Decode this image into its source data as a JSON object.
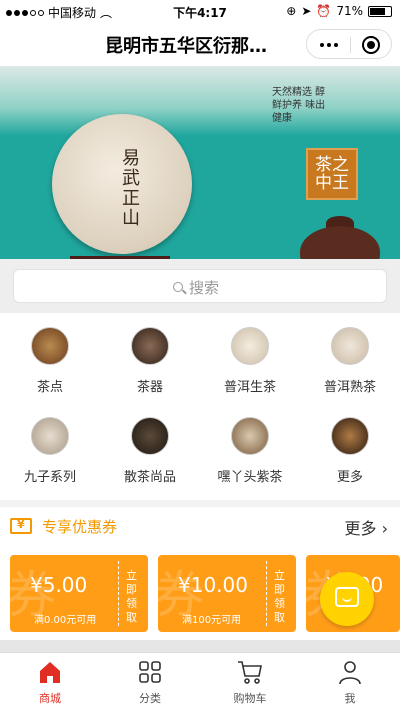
{
  "status_bar": {
    "carrier": "中国移动",
    "time": "下午4:17",
    "battery": "71%"
  },
  "nav": {
    "title": "昆明市五华区衍那…"
  },
  "banner": {
    "cake_text": "易武正山",
    "slogan": "天然精选 醇鲜护养 味出健康",
    "seal_text": "茶之中王",
    "slide_count": 3,
    "active_slide": 1
  },
  "search": {
    "placeholder": "搜索"
  },
  "categories": [
    {
      "label": "茶点"
    },
    {
      "label": "茶器"
    },
    {
      "label": "普洱生茶"
    },
    {
      "label": "普洱熟茶"
    },
    {
      "label": "九子系列"
    },
    {
      "label": "散茶尚品"
    },
    {
      "label": "嘿丫头紫茶"
    },
    {
      "label": "更多"
    }
  ],
  "coupon_section": {
    "title": "专享优惠券",
    "more": "更多"
  },
  "coupons": [
    {
      "amount": "¥5.00",
      "condition": "满0.00元可用",
      "action": "立即领取"
    },
    {
      "amount": "¥10.00",
      "condition": "满100元可用",
      "action": "立即领取"
    },
    {
      "amount": "¥5.00",
      "condition": "",
      "action": ""
    }
  ],
  "tabs": [
    {
      "label": "商城",
      "icon": "home-icon",
      "active": true
    },
    {
      "label": "分类",
      "icon": "grid-icon",
      "active": false
    },
    {
      "label": "购物车",
      "icon": "cart-icon",
      "active": false
    },
    {
      "label": "我",
      "icon": "user-icon",
      "active": false
    }
  ],
  "colors": {
    "accent": "#f39800",
    "coupon": "#ff9d17",
    "active_tab": "#e02e24",
    "chat": "#ffd200",
    "banner": "#1fa79e"
  }
}
